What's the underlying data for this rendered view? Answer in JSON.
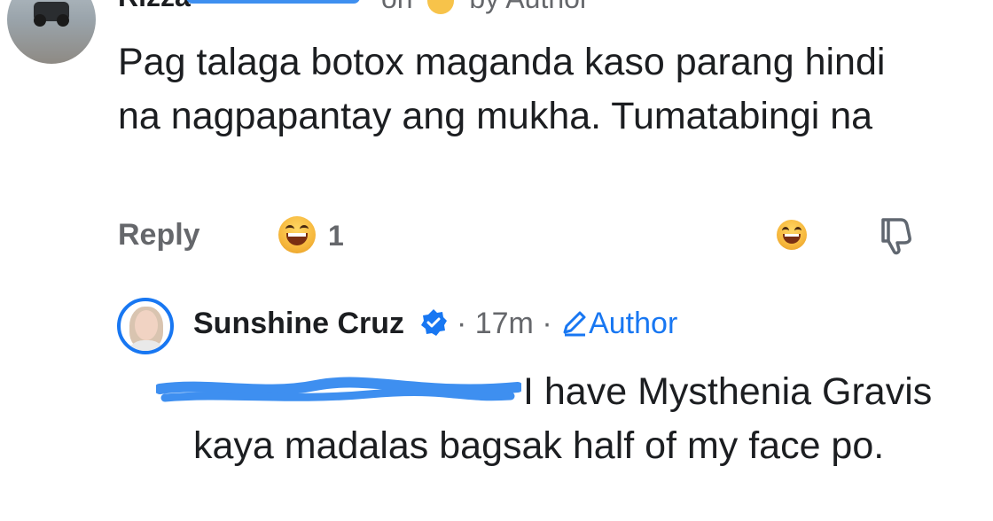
{
  "top_comment": {
    "author": "Rizza",
    "meta_prefix": "on",
    "meta_suffix": "by Author",
    "text": "Pag talaga botox maganda kaso parang hindi na nagpapantay ang mukha. Tumatabingi na",
    "reply_label": "Reply",
    "reaction_count": "1"
  },
  "reply": {
    "author": "Sunshine Cruz",
    "time": "17m",
    "author_badge": "Author",
    "text": "I have Mysthenia Gravis kaya madalas bagsak half of my face po."
  },
  "icons": {
    "reaction": "laughing-emoji-icon",
    "dislike": "thumbs-down-icon",
    "verified": "verified-badge-icon",
    "author": "pencil-icon"
  },
  "colors": {
    "accent": "#1877f2",
    "meta": "#65676b",
    "scribble": "#3e8ff0"
  }
}
